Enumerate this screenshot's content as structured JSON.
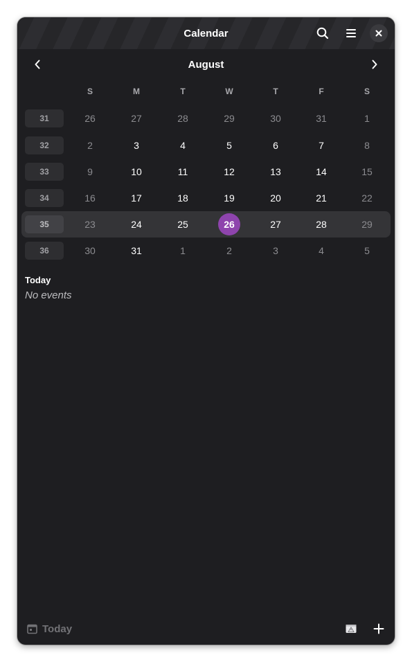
{
  "window": {
    "title": "Calendar"
  },
  "header": {
    "icons": [
      "search-icon",
      "hamburger-menu-icon",
      "close-icon"
    ]
  },
  "month": {
    "name": "August",
    "prev_icon": "chevron-left-icon",
    "next_icon": "chevron-right-icon"
  },
  "weekdays": [
    "S",
    "M",
    "T",
    "W",
    "T",
    "F",
    "S"
  ],
  "weeks": [
    {
      "number": "31",
      "days": [
        "26",
        "27",
        "28",
        "29",
        "30",
        "31",
        "1"
      ],
      "dim": [
        true,
        true,
        true,
        true,
        true,
        true,
        true
      ],
      "current": false
    },
    {
      "number": "32",
      "days": [
        "2",
        "3",
        "4",
        "5",
        "6",
        "7",
        "8"
      ],
      "dim": [
        true,
        false,
        false,
        false,
        false,
        false,
        true
      ],
      "current": false
    },
    {
      "number": "33",
      "days": [
        "9",
        "10",
        "11",
        "12",
        "13",
        "14",
        "15"
      ],
      "dim": [
        true,
        false,
        false,
        false,
        false,
        false,
        true
      ],
      "current": false
    },
    {
      "number": "34",
      "days": [
        "16",
        "17",
        "18",
        "19",
        "20",
        "21",
        "22"
      ],
      "dim": [
        true,
        false,
        false,
        false,
        false,
        false,
        true
      ],
      "current": false
    },
    {
      "number": "35",
      "days": [
        "23",
        "24",
        "25",
        "26",
        "27",
        "28",
        "29"
      ],
      "dim": [
        true,
        false,
        false,
        false,
        false,
        false,
        true
      ],
      "current": true,
      "today_index": 3
    },
    {
      "number": "36",
      "days": [
        "30",
        "31",
        "1",
        "2",
        "3",
        "4",
        "5"
      ],
      "dim": [
        true,
        false,
        true,
        true,
        true,
        true,
        true
      ],
      "current": false
    }
  ],
  "agenda": {
    "heading": "Today",
    "empty_text": "No events"
  },
  "footer": {
    "today_label": "Today",
    "icons": [
      "calendar-icon",
      "calendar-warning-icon",
      "add-icon"
    ]
  },
  "colors": {
    "today_accent": "#8e44ad",
    "window_bg": "#1e1e21"
  }
}
